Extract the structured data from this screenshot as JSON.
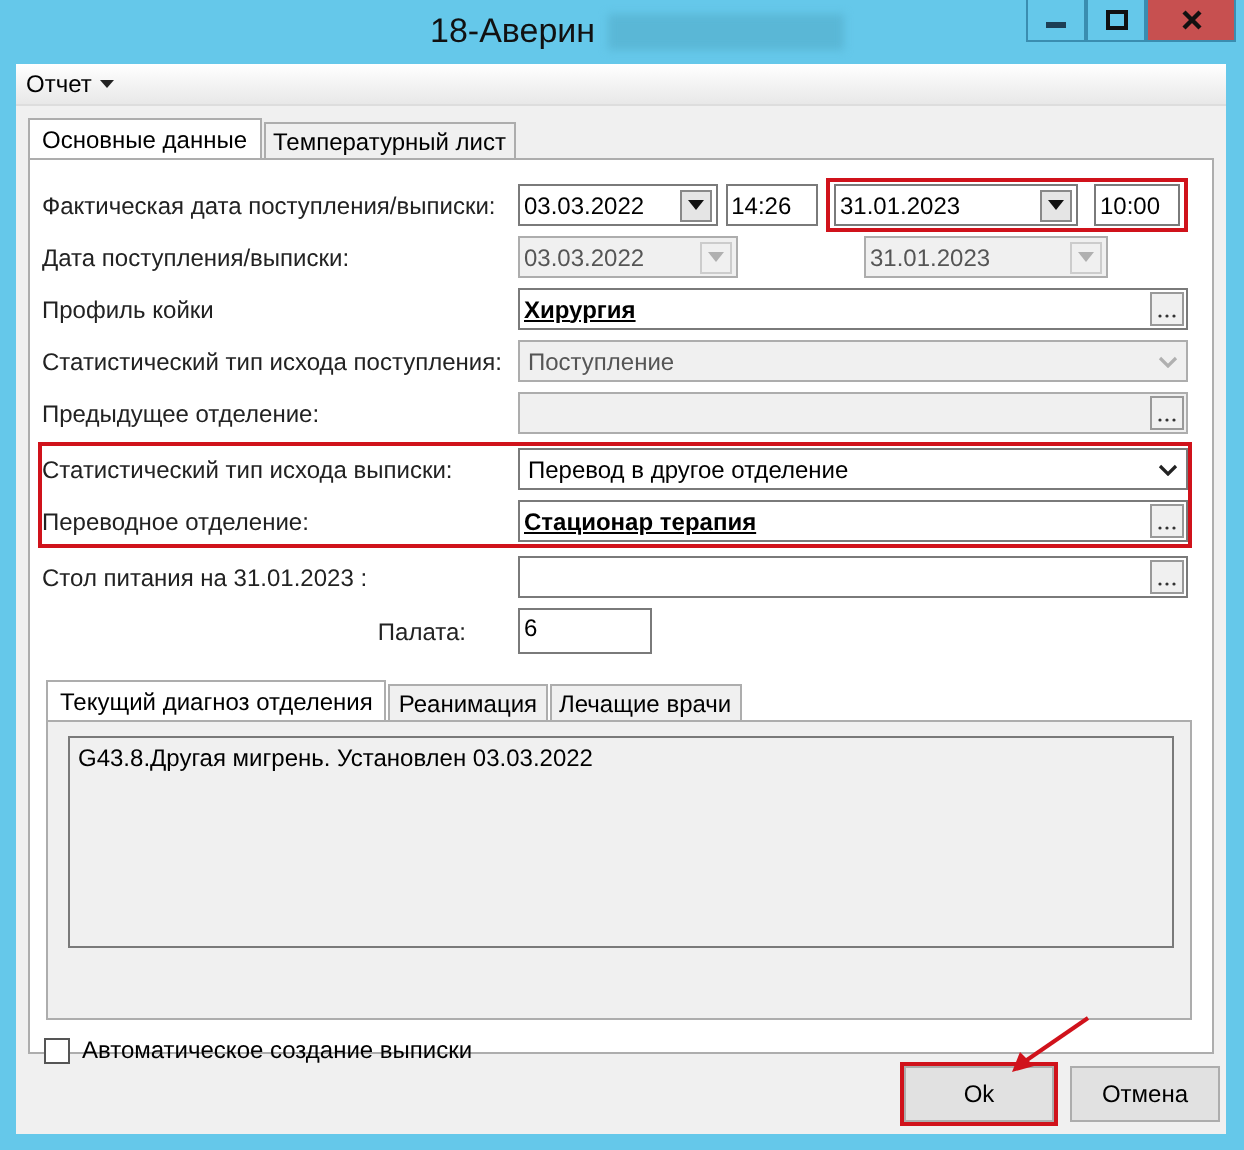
{
  "window": {
    "title": "18-Аверин",
    "title_redacted": true
  },
  "menu": [
    {
      "label": "Отчет",
      "dropdown": true
    }
  ],
  "tabs": [
    {
      "label": "Основные данные",
      "selected": true
    },
    {
      "label": "Температурный лист",
      "selected": false
    }
  ],
  "form": {
    "groups": [
      {
        "highlighted": false,
        "rows": [
          {
            "kind": "dates",
            "label": "Фактическая дата поступления/выписки:",
            "disabled": false,
            "start": {
              "date": "03.03.2022",
              "time": "14:26"
            },
            "end": {
              "date": "31.01.2023",
              "time": "10:00",
              "highlighted": true
            }
          },
          {
            "kind": "dates",
            "label": "Дата поступления/выписки:",
            "disabled": true,
            "start": {
              "date": "03.03.2022"
            },
            "end": {
              "date": "31.01.2023",
              "highlighted": false
            }
          },
          {
            "kind": "lookup",
            "label": "Профиль койки",
            "disabled": false,
            "value": "Хирургия"
          },
          {
            "kind": "select",
            "label": "Статистический тип исхода поступления:",
            "disabled": true,
            "value": "Поступление"
          },
          {
            "kind": "lookup",
            "label": "Предыдущее отделение:",
            "disabled": true
          }
        ]
      },
      {
        "highlighted": true,
        "rows": [
          {
            "kind": "select",
            "label": "Статистический тип исхода выписки:",
            "disabled": false,
            "value": "Перевод в другое отделение"
          },
          {
            "kind": "lookup",
            "label": "Переводное отделение:",
            "disabled": false,
            "value": "Стационар  терапия"
          }
        ]
      },
      {
        "highlighted": false,
        "rows": [
          {
            "kind": "lookup",
            "label": "Стол питания на 31.01.2023 :",
            "disabled": false
          },
          {
            "kind": "short",
            "label": "Палата:",
            "disabled": false,
            "value": "6"
          }
        ]
      }
    ]
  },
  "subtabs": [
    {
      "label": "Текущий диагноз отделения",
      "selected": true
    },
    {
      "label": "Реанимация",
      "selected": false
    },
    {
      "label": "Лечащие врачи",
      "selected": false
    }
  ],
  "diagnosis": "G43.8.Другая мигрень. Установлен 03.03.2022",
  "auto_discharge": {
    "label": "Автоматическое создание выписки",
    "checked": false
  },
  "buttons": [
    {
      "label": "Ok",
      "highlighted": true
    },
    {
      "label": "Отмена",
      "highlighted": false
    }
  ],
  "pointer_arrow": true
}
